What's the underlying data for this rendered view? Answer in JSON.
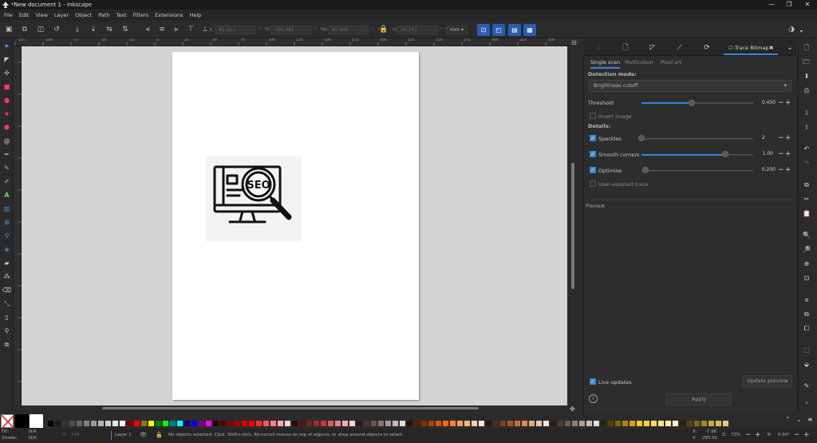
{
  "window": {
    "title": "*New document 1 - Inkscape",
    "controls": [
      "—",
      "❐",
      "✕"
    ]
  },
  "menu": [
    "File",
    "Edit",
    "View",
    "Layer",
    "Object",
    "Path",
    "Text",
    "Filters",
    "Extensions",
    "Help"
  ],
  "toolbar": {
    "x_label": "X:",
    "x_value": "85.221",
    "y_label": "Y:",
    "y_value": "100.461",
    "w_label": "W:",
    "w_value": "87.666",
    "h_label": "H:",
    "h_value": "56.262",
    "unit": "mm"
  },
  "ruler_ticks": [
    "-125",
    "-100",
    "-75",
    "-50",
    "-25",
    "0",
    "25",
    "50",
    "75",
    "100",
    "125",
    "150",
    "175",
    "200",
    "225",
    "250",
    "275",
    "300",
    "325",
    "350"
  ],
  "canvas": {
    "image_text": "SEO"
  },
  "panel": {
    "tab_label": "Trace Bitmap",
    "subtabs": [
      "Single scan",
      "Multicolour",
      "Pixel art"
    ],
    "detection_mode_label": "Detection mode:",
    "detection_mode_value": "Brightness cutoff",
    "threshold_label": "Threshold",
    "threshold_value": "0.450",
    "threshold_fraction": 0.45,
    "invert_label": "Invert image",
    "details_label": "Details:",
    "speckles_label": "Speckles",
    "speckles_value": "2",
    "smooth_label": "Smooth corners",
    "smooth_value": "1.00",
    "smooth_fraction": 0.75,
    "optimise_label": "Optimise",
    "optimise_value": "0.200",
    "user_assisted_label": "User-assisted trace",
    "preview_label": "Preview:",
    "live_updates_label": "Live updates",
    "update_preview_label": "Update preview",
    "apply_label": "Apply"
  },
  "status": {
    "fill_label": "Fill:",
    "fill_value": "N/A",
    "stroke_label": "Stroke:",
    "stroke_value": "N/A",
    "opacity_label": "O:",
    "opacity_value": "100",
    "layer": "Layer 1",
    "message": "No objects selected. Click, Shift+click, Alt+scroll mouse on top of objects, or drag around objects to select.",
    "cursor_x_label": "X:",
    "cursor_x": "-7.98",
    "cursor_y_label": "Y:",
    "cursor_y": "295.91",
    "zoom_label": "Z:",
    "zoom": "73%",
    "rotation_label": "R:",
    "rotation": "0.00°"
  },
  "palette_colors": [
    "#000000",
    "#1a1a1a",
    "#333333",
    "#4d4d4d",
    "#666666",
    "#808080",
    "#999999",
    "#b3b3b3",
    "#cccccc",
    "#e6e6e6",
    "#ffffff",
    "#800000",
    "#ff0000",
    "#808000",
    "#ffff00",
    "#008000",
    "#00ff00",
    "#008080",
    "#00ffff",
    "#000080",
    "#0000ff",
    "#800080",
    "#ff00ff",
    "#2b0000",
    "#550000",
    "#800000",
    "#aa0000",
    "#d40000",
    "#ff0000",
    "#ff2a2a",
    "#ff5555",
    "#ff8080",
    "#ffaaaa",
    "#ffd5d5",
    "#280b0b",
    "#501616",
    "#782121",
    "#a02c2c",
    "#c83737",
    "#d35f5f",
    "#de8787",
    "#e9afaf",
    "#f4d7d7",
    "#241c1c",
    "#483737",
    "#6c5353",
    "#916f6f",
    "#ac9393",
    "#c8b7b7",
    "#e3dbdb",
    "#2b1100",
    "#552200",
    "#803300",
    "#aa4400",
    "#d45500",
    "#ff6600",
    "#ff7f2a",
    "#ff9955",
    "#ffb380",
    "#ffccaa",
    "#ffe6d5",
    "#28170b",
    "#502d16",
    "#784421",
    "#a05a2c",
    "#c87137",
    "#d38d5f",
    "#deaa87",
    "#e9c6af",
    "#f4e3d7",
    "#241f1c",
    "#483e37",
    "#6c5d53",
    "#917c6f",
    "#ac9d93",
    "#c8beb7",
    "#e3dedb",
    "#2b2200",
    "#554400",
    "#806600",
    "#aa8800",
    "#d4aa00",
    "#ffcc00",
    "#ffd42a",
    "#ffdd55",
    "#ffe680",
    "#ffeeaa",
    "#fff6d5",
    "#28220b",
    "#504416",
    "#786721",
    "#a0892c",
    "#c8ab37",
    "#d3bc5f",
    "#decd87"
  ]
}
